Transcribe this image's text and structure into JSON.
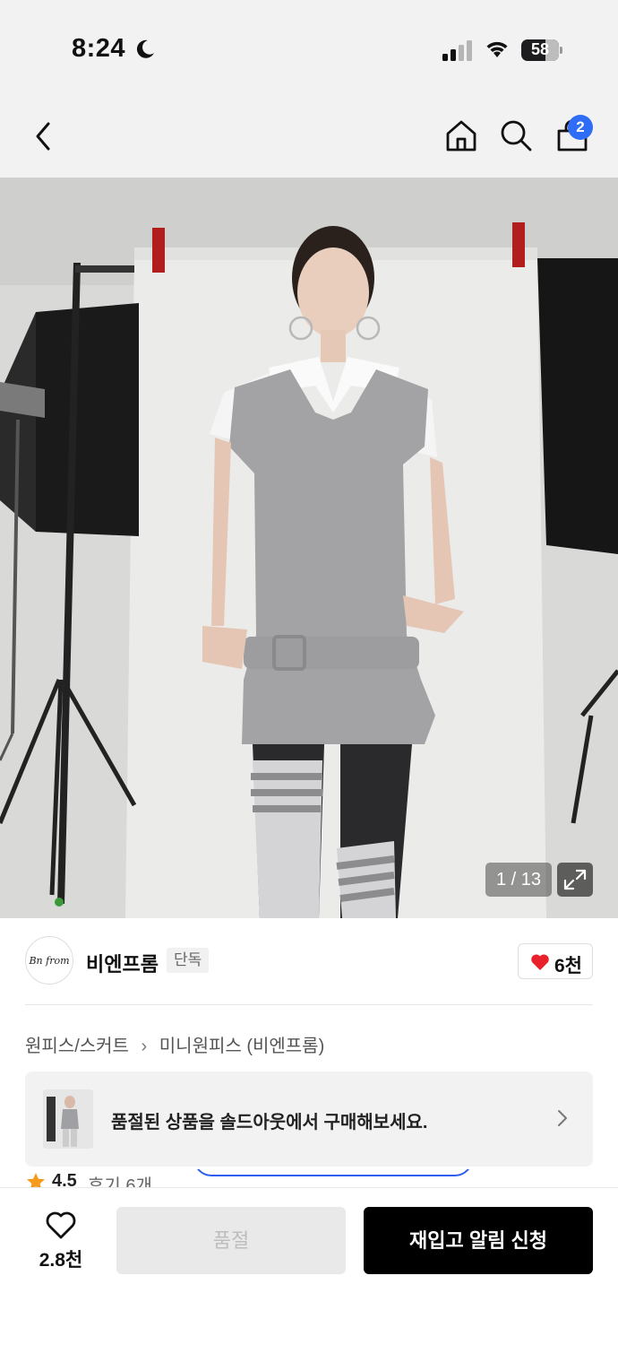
{
  "status_bar": {
    "time": "8:24",
    "battery": "58",
    "icons": [
      "moon-icon",
      "signal-icon",
      "wifi-icon",
      "battery-icon"
    ]
  },
  "nav": {
    "icons": [
      "back-icon",
      "home-icon",
      "search-icon",
      "shopping-bag-icon"
    ],
    "cart_badge": "2"
  },
  "gallery": {
    "counter": "1 / 13",
    "expand_icon": "expand-icon"
  },
  "brand": {
    "logo_text": "Bn from",
    "name": "비엔프롬",
    "tag": "단독",
    "like_count": "6천",
    "heart_color": "#e8212b"
  },
  "breadcrumb": {
    "category": "원피스/스커트",
    "subcategory": "미니원피스 (비엔프롬)"
  },
  "promo": {
    "text": "품절된 상품을 솔드아웃에서 구매해보세요."
  },
  "rating": {
    "score": "4.5",
    "reviews": "후기 6개",
    "star_color": "#f59a1b"
  },
  "bottom_bar": {
    "wish_count": "2.8천",
    "soldout_label": "품절",
    "restock_label": "재입고 알림 신청"
  },
  "colors": {
    "accent_blue": "#2f6df6",
    "primary_button": "#000000"
  }
}
